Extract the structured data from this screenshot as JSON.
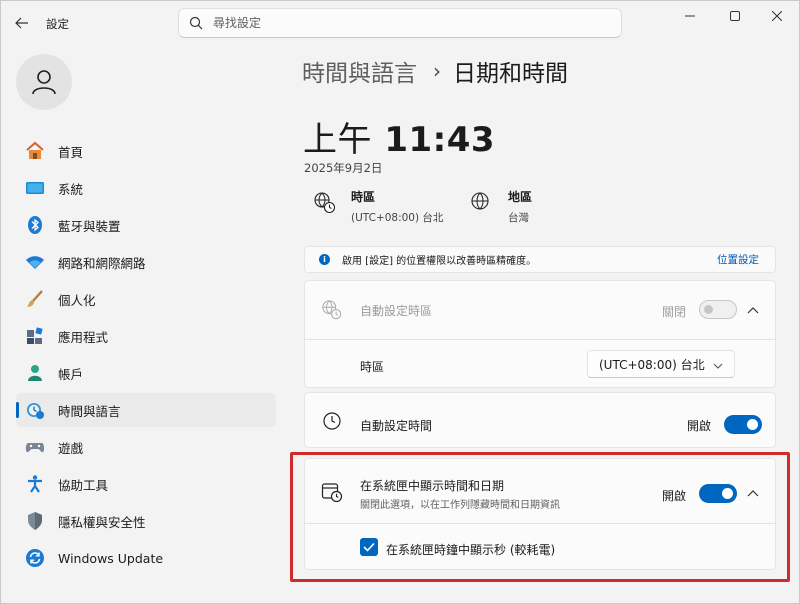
{
  "window": {
    "title": "設定",
    "icons": {
      "back": "back-arrow-icon",
      "minimize": "minimize-icon",
      "maximize": "maximize-icon",
      "close": "close-icon"
    }
  },
  "search": {
    "placeholder": "尋找設定",
    "value": ""
  },
  "sidebar": {
    "items": [
      {
        "label": "首頁",
        "icon": "home-icon"
      },
      {
        "label": "系統",
        "icon": "system-icon"
      },
      {
        "label": "藍牙與裝置",
        "icon": "bluetooth-icon"
      },
      {
        "label": "網路和網際網路",
        "icon": "wifi-icon"
      },
      {
        "label": "個人化",
        "icon": "brush-icon"
      },
      {
        "label": "應用程式",
        "icon": "apps-icon"
      },
      {
        "label": "帳戶",
        "icon": "account-icon"
      },
      {
        "label": "時間與語言",
        "icon": "time-language-icon",
        "active": true
      },
      {
        "label": "遊戲",
        "icon": "gaming-icon"
      },
      {
        "label": "協助工具",
        "icon": "accessibility-icon"
      },
      {
        "label": "隱私權與安全性",
        "icon": "shield-icon"
      },
      {
        "label": "Windows Update",
        "icon": "update-icon"
      }
    ]
  },
  "breadcrumb": {
    "parent": "時間與語言",
    "separator": "›",
    "current": "日期和時間"
  },
  "clock": {
    "ampm": "上午",
    "time": "11:43",
    "date": "2025年9月2日"
  },
  "info": {
    "timezone": {
      "title": "時區",
      "value": "(UTC+08:00) 台北"
    },
    "region": {
      "title": "地區",
      "value": "台灣"
    }
  },
  "banner": {
    "text": "啟用 [設定] 的位置權限以改善時區精確度。",
    "link": "位置設定"
  },
  "auto_timezone": {
    "title": "自動設定時區",
    "state": "關閉",
    "on": false,
    "disabled": true
  },
  "timezone_select": {
    "label": "時區",
    "value": "(UTC+08:00) 台北"
  },
  "auto_time": {
    "title": "自動設定時間",
    "state": "開啟",
    "on": true
  },
  "tray": {
    "title": "在系統匣中顯示時間和日期",
    "subtitle": "關閉此選項，以在工作列隱藏時間和日期資訊",
    "state": "開啟",
    "on": true,
    "seconds_checkbox": {
      "label": "在系統匣時鐘中顯示秒 (較耗電)",
      "checked": true
    }
  },
  "colors": {
    "accent": "#0067c0",
    "highlight": "#d02a2a"
  }
}
